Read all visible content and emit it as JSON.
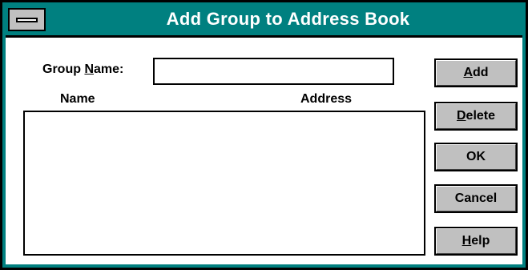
{
  "window": {
    "title": "Add Group to Address Book",
    "titlebar_color": "#008080",
    "system_menu_icon": "system-menu-icon"
  },
  "form": {
    "group_name_label_prefix": "Group ",
    "group_name_label_accel": "N",
    "group_name_label_suffix": "ame:",
    "group_name_value": "",
    "columns": {
      "name": "Name",
      "address": "Address"
    },
    "list_items": []
  },
  "buttons": {
    "add": {
      "accel": "A",
      "rest": "dd"
    },
    "delete": {
      "accel": "D",
      "rest": "elete"
    },
    "ok": {
      "label": "OK"
    },
    "cancel": {
      "label": "Cancel"
    },
    "help": {
      "accel": "H",
      "rest": "elp"
    }
  }
}
